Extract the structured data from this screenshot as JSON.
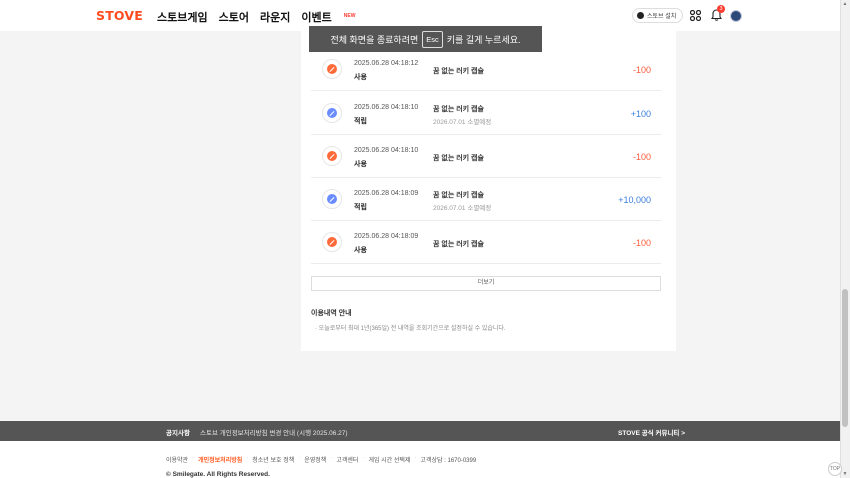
{
  "header": {
    "logo": "STOVE",
    "nav": [
      "스토브게임",
      "스토어",
      "라운지",
      "이벤트"
    ],
    "new_badge": "NEW",
    "install_label": "스토브 설치",
    "notification_count": "3"
  },
  "esc_toast": {
    "before": "전체 화면을 종료하려면",
    "key": "Esc",
    "after": "키를 길게 누르세요."
  },
  "history": [
    {
      "date": "2025.06.28 04:18:12",
      "type": "사용",
      "desc": "꿈 없는 러키 캡슐",
      "sub": "",
      "amount": "-100",
      "kind": "use"
    },
    {
      "date": "2025.06.28 04:18:10",
      "type": "적립",
      "desc": "꿈 없는 러키 캡슐",
      "sub": "2026.07.01 소멸예정",
      "amount": "+100",
      "kind": "save"
    },
    {
      "date": "2025.06.28 04:18:10",
      "type": "사용",
      "desc": "꿈 없는 러키 캡슐",
      "sub": "",
      "amount": "-100",
      "kind": "use"
    },
    {
      "date": "2025.06.28 04:18:09",
      "type": "적립",
      "desc": "꿈 없는 러키 캡슐",
      "sub": "2026.07.01 소멸예정",
      "amount": "+10,000",
      "kind": "save"
    },
    {
      "date": "2025.06.28 04:18:09",
      "type": "사용",
      "desc": "꿈 없는 러키 캡슐",
      "sub": "",
      "amount": "-100",
      "kind": "use"
    }
  ],
  "more_label": "더보기",
  "notice": {
    "title": "이용내역 안내",
    "item": "오늘로부터 최대 1년(365일) 전 내역을 조회기간으로 설정하실 수 있습니다."
  },
  "notice_bar": {
    "label": "공지사항",
    "text": "스토브 개인정보처리방침 변경 안내 (시행 2025.06.27)",
    "community": "STOVE 공식 커뮤니티 >"
  },
  "footer": {
    "links": [
      "이용약관",
      "개인정보처리방침",
      "청소년 보호 정책",
      "운영정책",
      "고객센터",
      "게임 시간 선택제",
      "고객상담 : 1670-0399"
    ],
    "highlight_index": 1,
    "copyright": "© Smilegate. All Rights Reserved."
  },
  "top_button": "TOP",
  "colors": {
    "brand": "#ff4c1f",
    "minus": "#ff5a3a",
    "plus": "#3b7ddd"
  }
}
